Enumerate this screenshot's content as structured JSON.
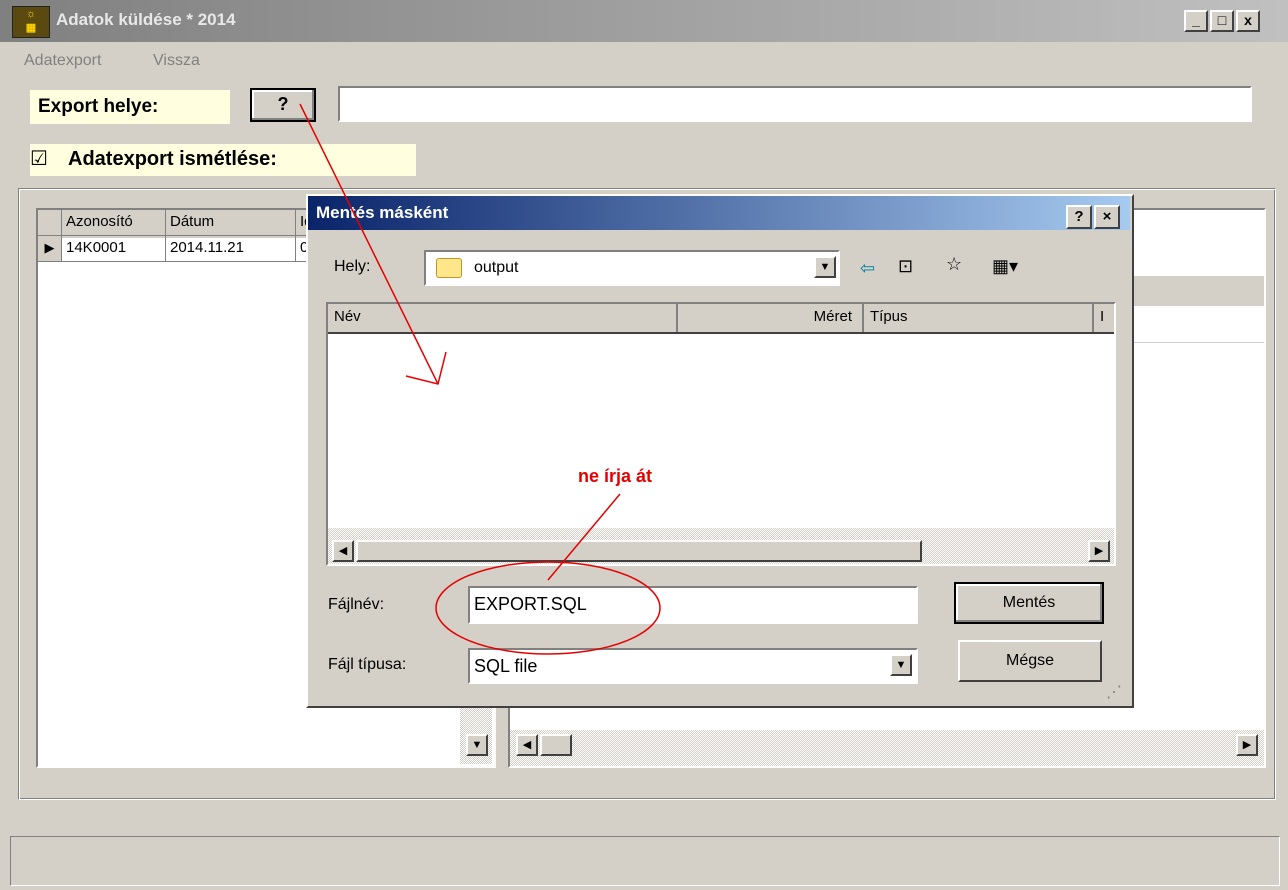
{
  "window": {
    "title": "Adatok küldése * 2014",
    "min_label": "_",
    "max_label": "□",
    "close_label": "x"
  },
  "menu": {
    "items": [
      "Adatexport",
      "Vissza"
    ]
  },
  "export": {
    "label": "Export helye:",
    "browse_label": "?",
    "path_value": ""
  },
  "repeat": {
    "label": "Adatexport ismétlése:",
    "checked": true,
    "check_glyph": "☑"
  },
  "grid": {
    "columns": [
      "Azonosító",
      "Dátum",
      "Id"
    ],
    "rows": [
      {
        "azonosito": "14K0001",
        "datum": "2014.11.21",
        "id": "0"
      }
    ]
  },
  "dialog": {
    "title": "Mentés másként",
    "help_label": "?",
    "close_label": "×",
    "location_label": "Hely:",
    "location_value": "output",
    "list_columns": [
      "Név",
      "Méret",
      "Típus",
      "I"
    ],
    "filename_label": "Fájlnév:",
    "filename_value": "EXPORT.SQL",
    "filetype_label": "Fájl típusa:",
    "filetype_value": "SQL file",
    "save_label": "Mentés",
    "cancel_label": "Mégse"
  },
  "annotation": {
    "text": "ne írja át",
    "color": "#e60000"
  }
}
